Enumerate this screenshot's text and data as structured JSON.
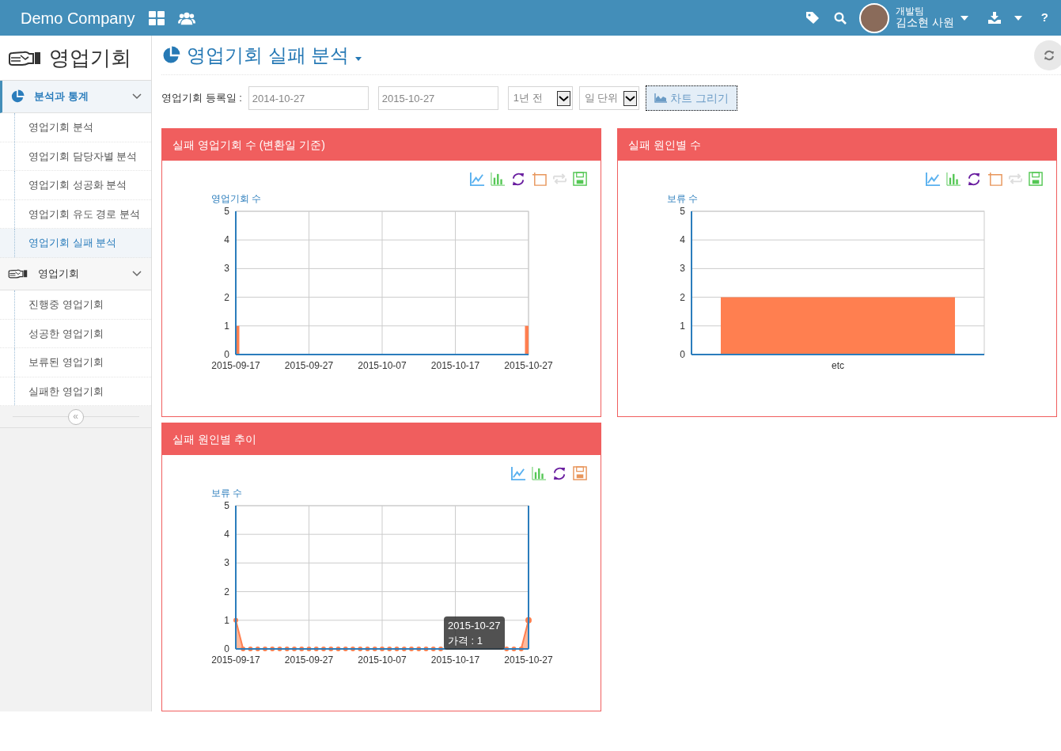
{
  "navbar": {
    "brand": "Demo Company",
    "user": {
      "team": "개발팀",
      "name": "김소현 사원"
    },
    "help": "?"
  },
  "sidebar": {
    "title": "영업기회",
    "collapse": "«",
    "groups": [
      {
        "label": "분석과 통계",
        "expanded": true,
        "selected": true,
        "items": [
          {
            "label": "영업기회 분석",
            "selected": false
          },
          {
            "label": "영업기회 담당자별 분석",
            "selected": false
          },
          {
            "label": "영업기회 성공화 분석",
            "selected": false
          },
          {
            "label": "영업기회 유도 경로 분석",
            "selected": false
          },
          {
            "label": "영업기회 실패 분석",
            "selected": true
          }
        ]
      },
      {
        "label": "영업기회",
        "expanded": true,
        "selected": false,
        "items": [
          {
            "label": "진행중 영업기회",
            "selected": false
          },
          {
            "label": "성공한 영업기회",
            "selected": false
          },
          {
            "label": "보류된 영업기회",
            "selected": false
          },
          {
            "label": "실패한 영업기회",
            "selected": false
          }
        ]
      }
    ]
  },
  "page": {
    "title": "영업기회 실패 분석"
  },
  "filter": {
    "label": "영업기회 등록일 :",
    "start": "2014-10-27",
    "end": "2015-10-27",
    "period": "1년 전",
    "unit": "일 단위",
    "button": "차트 그리기"
  },
  "panels": [
    {
      "title": "실패 영업기회 수 (변환일 기준)",
      "toolbar": [
        {
          "kind": "line",
          "color": "#5ab1ef"
        },
        {
          "kind": "bar",
          "color": "#54c754"
        },
        {
          "kind": "refresh",
          "color": "#6a1fa0"
        },
        {
          "kind": "zoom",
          "color": "#e8955a"
        },
        {
          "kind": "zoom-reset",
          "color": "#dddddd"
        },
        {
          "kind": "save",
          "color": "#54c754"
        }
      ],
      "chart_data": {
        "type": "bar",
        "ylabel": "영업기회 수",
        "grid": true,
        "ylim": [
          0,
          5
        ],
        "yticks": [
          0,
          1,
          2,
          3,
          4,
          5
        ],
        "categories": [
          "2015-09-17",
          null,
          null,
          null,
          null,
          null,
          null,
          null,
          null,
          null,
          "2015-09-27",
          null,
          null,
          null,
          null,
          null,
          null,
          null,
          null,
          null,
          "2015-10-07",
          null,
          null,
          null,
          null,
          null,
          null,
          null,
          null,
          null,
          "2015-10-17",
          null,
          null,
          null,
          null,
          null,
          null,
          null,
          null,
          null,
          "2015-10-27"
        ],
        "series": [
          {
            "color": "#ff7f50",
            "values": [
              1,
              0,
              0,
              0,
              0,
              0,
              0,
              0,
              0,
              0,
              0,
              0,
              0,
              0,
              0,
              0,
              0,
              0,
              0,
              0,
              0,
              0,
              0,
              0,
              0,
              0,
              0,
              0,
              0,
              0,
              0,
              0,
              0,
              0,
              0,
              0,
              0,
              0,
              0,
              0,
              1
            ]
          }
        ]
      }
    },
    {
      "title": "실패 원인별 수",
      "toolbar": [
        {
          "kind": "line",
          "color": "#5ab1ef"
        },
        {
          "kind": "bar",
          "color": "#54c754"
        },
        {
          "kind": "refresh",
          "color": "#6a1fa0"
        },
        {
          "kind": "zoom",
          "color": "#e8955a"
        },
        {
          "kind": "zoom-reset",
          "color": "#dddddd"
        },
        {
          "kind": "save",
          "color": "#54c754"
        }
      ],
      "chart_data": {
        "type": "bar",
        "ylabel": "보류 수",
        "grid": true,
        "ylim": [
          0,
          5
        ],
        "yticks": [
          0,
          1,
          2,
          3,
          4,
          5
        ],
        "categories": [
          "etc"
        ],
        "series": [
          {
            "color": "#ff7f50",
            "values": [
              2
            ]
          }
        ]
      }
    },
    {
      "title": "실패 원인별 추이",
      "toolbar": [
        {
          "kind": "line",
          "color": "#5ab1ef"
        },
        {
          "kind": "bar",
          "color": "#54c754"
        },
        {
          "kind": "refresh",
          "color": "#6a1fa0"
        },
        {
          "kind": "save",
          "color": "#e8955a"
        }
      ],
      "tooltip": {
        "title": "2015-10-27",
        "text": "가격 : 1"
      },
      "chart_data": {
        "type": "area",
        "ylabel": "보류 수",
        "grid": true,
        "ylim": [
          0,
          5
        ],
        "yticks": [
          0,
          1,
          2,
          3,
          4,
          5
        ],
        "categories": [
          "2015-09-17",
          null,
          null,
          null,
          null,
          null,
          null,
          null,
          null,
          null,
          "2015-09-27",
          null,
          null,
          null,
          null,
          null,
          null,
          null,
          null,
          null,
          "2015-10-07",
          null,
          null,
          null,
          null,
          null,
          null,
          null,
          null,
          null,
          "2015-10-17",
          null,
          null,
          null,
          null,
          null,
          null,
          null,
          null,
          null,
          "2015-10-27"
        ],
        "series": [
          {
            "color": "#ff7f50",
            "values": [
              1,
              0,
              0,
              0,
              0,
              0,
              0,
              0,
              0,
              0,
              0,
              0,
              0,
              0,
              0,
              0,
              0,
              0,
              0,
              0,
              0,
              0,
              0,
              0,
              0,
              0,
              0,
              0,
              0,
              null,
              null,
              null,
              null,
              null,
              null,
              null,
              null,
              0,
              0,
              0,
              1
            ]
          }
        ]
      }
    }
  ]
}
